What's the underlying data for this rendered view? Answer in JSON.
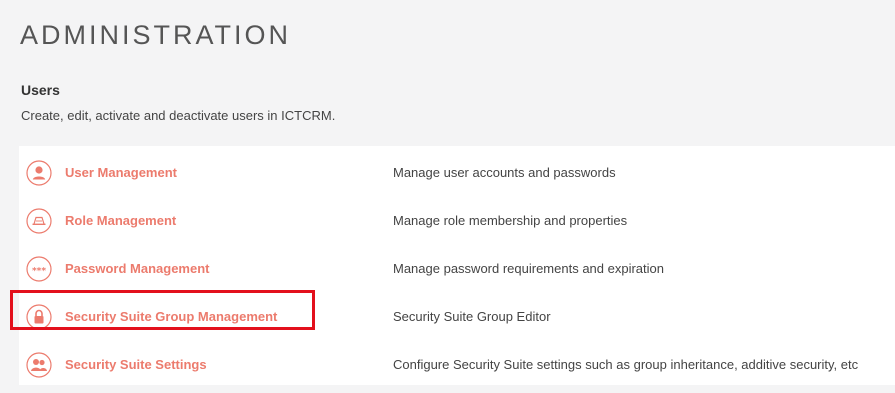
{
  "page": {
    "title": "ADMINISTRATION"
  },
  "section": {
    "title": "Users",
    "description": "Create, edit, activate and deactivate users in ICTCRM."
  },
  "items": [
    {
      "label": "User Management",
      "description": "Manage user accounts and passwords",
      "icon": "user-icon"
    },
    {
      "label": "Role Management",
      "description": "Manage role membership and properties",
      "icon": "role-hat-icon"
    },
    {
      "label": "Password Management",
      "description": "Manage password requirements and expiration",
      "icon": "password-asterisks-icon"
    },
    {
      "label": "Security Suite Group Management",
      "description": "Security Suite Group Editor",
      "icon": "lock-icon"
    },
    {
      "label": "Security Suite Settings",
      "description": "Configure Security Suite settings such as group inheritance, additive security, etc",
      "icon": "users-group-icon"
    }
  ],
  "colors": {
    "accent": "#ec7b6d",
    "highlight": "#e3101c",
    "background": "#f4f4f5",
    "panel": "#ffffff"
  }
}
